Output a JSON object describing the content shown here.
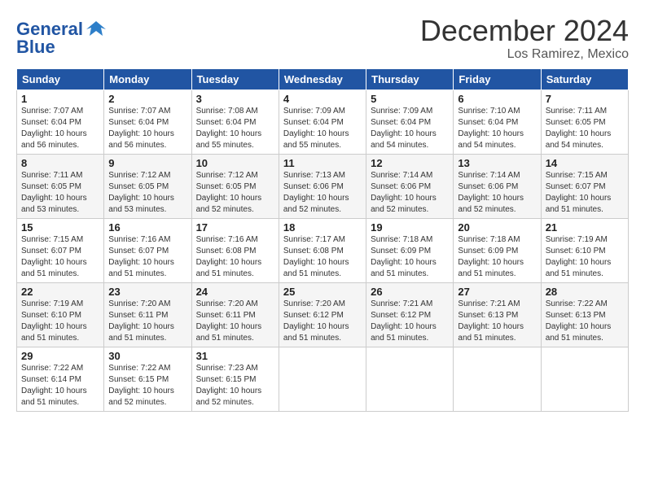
{
  "header": {
    "logo_text1": "General",
    "logo_text2": "Blue",
    "month": "December 2024",
    "location": "Los Ramirez, Mexico"
  },
  "weekdays": [
    "Sunday",
    "Monday",
    "Tuesday",
    "Wednesday",
    "Thursday",
    "Friday",
    "Saturday"
  ],
  "weeks": [
    [
      {
        "day": "1",
        "info": "Sunrise: 7:07 AM\nSunset: 6:04 PM\nDaylight: 10 hours\nand 56 minutes."
      },
      {
        "day": "2",
        "info": "Sunrise: 7:07 AM\nSunset: 6:04 PM\nDaylight: 10 hours\nand 56 minutes."
      },
      {
        "day": "3",
        "info": "Sunrise: 7:08 AM\nSunset: 6:04 PM\nDaylight: 10 hours\nand 55 minutes."
      },
      {
        "day": "4",
        "info": "Sunrise: 7:09 AM\nSunset: 6:04 PM\nDaylight: 10 hours\nand 55 minutes."
      },
      {
        "day": "5",
        "info": "Sunrise: 7:09 AM\nSunset: 6:04 PM\nDaylight: 10 hours\nand 54 minutes."
      },
      {
        "day": "6",
        "info": "Sunrise: 7:10 AM\nSunset: 6:04 PM\nDaylight: 10 hours\nand 54 minutes."
      },
      {
        "day": "7",
        "info": "Sunrise: 7:11 AM\nSunset: 6:05 PM\nDaylight: 10 hours\nand 54 minutes."
      }
    ],
    [
      {
        "day": "8",
        "info": "Sunrise: 7:11 AM\nSunset: 6:05 PM\nDaylight: 10 hours\nand 53 minutes."
      },
      {
        "day": "9",
        "info": "Sunrise: 7:12 AM\nSunset: 6:05 PM\nDaylight: 10 hours\nand 53 minutes."
      },
      {
        "day": "10",
        "info": "Sunrise: 7:12 AM\nSunset: 6:05 PM\nDaylight: 10 hours\nand 52 minutes."
      },
      {
        "day": "11",
        "info": "Sunrise: 7:13 AM\nSunset: 6:06 PM\nDaylight: 10 hours\nand 52 minutes."
      },
      {
        "day": "12",
        "info": "Sunrise: 7:14 AM\nSunset: 6:06 PM\nDaylight: 10 hours\nand 52 minutes."
      },
      {
        "day": "13",
        "info": "Sunrise: 7:14 AM\nSunset: 6:06 PM\nDaylight: 10 hours\nand 52 minutes."
      },
      {
        "day": "14",
        "info": "Sunrise: 7:15 AM\nSunset: 6:07 PM\nDaylight: 10 hours\nand 51 minutes."
      }
    ],
    [
      {
        "day": "15",
        "info": "Sunrise: 7:15 AM\nSunset: 6:07 PM\nDaylight: 10 hours\nand 51 minutes."
      },
      {
        "day": "16",
        "info": "Sunrise: 7:16 AM\nSunset: 6:07 PM\nDaylight: 10 hours\nand 51 minutes."
      },
      {
        "day": "17",
        "info": "Sunrise: 7:16 AM\nSunset: 6:08 PM\nDaylight: 10 hours\nand 51 minutes."
      },
      {
        "day": "18",
        "info": "Sunrise: 7:17 AM\nSunset: 6:08 PM\nDaylight: 10 hours\nand 51 minutes."
      },
      {
        "day": "19",
        "info": "Sunrise: 7:18 AM\nSunset: 6:09 PM\nDaylight: 10 hours\nand 51 minutes."
      },
      {
        "day": "20",
        "info": "Sunrise: 7:18 AM\nSunset: 6:09 PM\nDaylight: 10 hours\nand 51 minutes."
      },
      {
        "day": "21",
        "info": "Sunrise: 7:19 AM\nSunset: 6:10 PM\nDaylight: 10 hours\nand 51 minutes."
      }
    ],
    [
      {
        "day": "22",
        "info": "Sunrise: 7:19 AM\nSunset: 6:10 PM\nDaylight: 10 hours\nand 51 minutes."
      },
      {
        "day": "23",
        "info": "Sunrise: 7:20 AM\nSunset: 6:11 PM\nDaylight: 10 hours\nand 51 minutes."
      },
      {
        "day": "24",
        "info": "Sunrise: 7:20 AM\nSunset: 6:11 PM\nDaylight: 10 hours\nand 51 minutes."
      },
      {
        "day": "25",
        "info": "Sunrise: 7:20 AM\nSunset: 6:12 PM\nDaylight: 10 hours\nand 51 minutes."
      },
      {
        "day": "26",
        "info": "Sunrise: 7:21 AM\nSunset: 6:12 PM\nDaylight: 10 hours\nand 51 minutes."
      },
      {
        "day": "27",
        "info": "Sunrise: 7:21 AM\nSunset: 6:13 PM\nDaylight: 10 hours\nand 51 minutes."
      },
      {
        "day": "28",
        "info": "Sunrise: 7:22 AM\nSunset: 6:13 PM\nDaylight: 10 hours\nand 51 minutes."
      }
    ],
    [
      {
        "day": "29",
        "info": "Sunrise: 7:22 AM\nSunset: 6:14 PM\nDaylight: 10 hours\nand 51 minutes."
      },
      {
        "day": "30",
        "info": "Sunrise: 7:22 AM\nSunset: 6:15 PM\nDaylight: 10 hours\nand 52 minutes."
      },
      {
        "day": "31",
        "info": "Sunrise: 7:23 AM\nSunset: 6:15 PM\nDaylight: 10 hours\nand 52 minutes."
      },
      {
        "day": "",
        "info": ""
      },
      {
        "day": "",
        "info": ""
      },
      {
        "day": "",
        "info": ""
      },
      {
        "day": "",
        "info": ""
      }
    ]
  ]
}
